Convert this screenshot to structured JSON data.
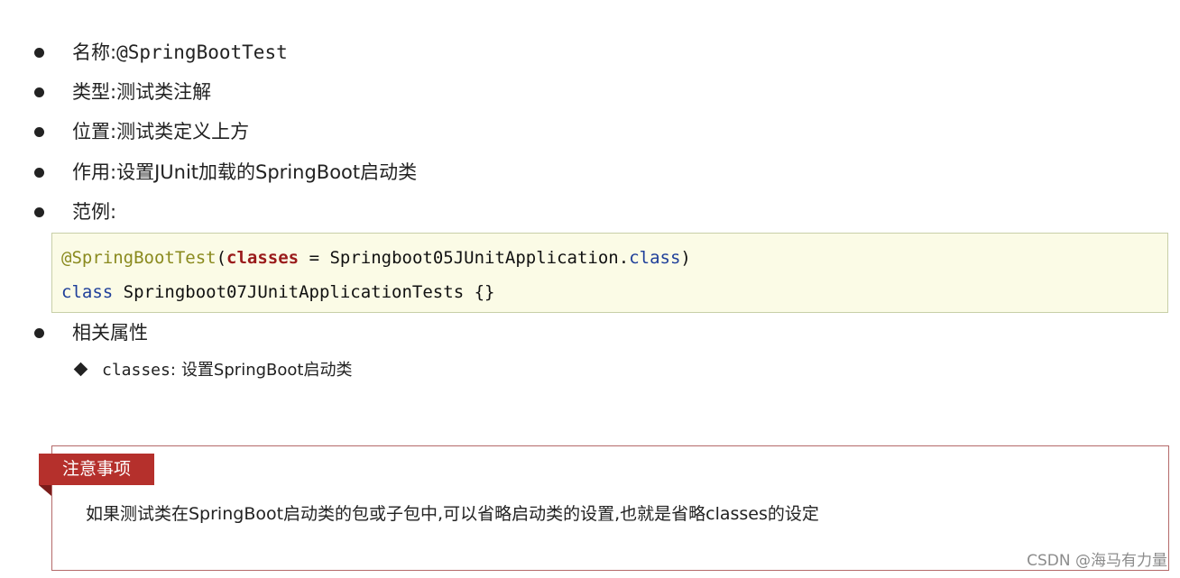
{
  "bullets": [
    {
      "label": "名称:",
      "value": "@SpringBootTest"
    },
    {
      "label": "类型:",
      "value": "测试类注解"
    },
    {
      "label": "位置:",
      "value": "测试类定义上方"
    },
    {
      "label": "作用:",
      "value": "设置JUnit加载的SpringBoot启动类"
    },
    {
      "label": "范例:",
      "value": ""
    }
  ],
  "code": {
    "line1": {
      "annotation": "@SpringBootTest",
      "paren_open": "(",
      "attr": "classes",
      "equals": " = ",
      "class_ref": "Springboot05JUnitApplication.",
      "class_kw": "class",
      "paren_close": ")"
    },
    "line2": {
      "keyword": "class",
      "rest": " Springboot07JUnitApplicationTests {}"
    }
  },
  "related": {
    "label": "相关属性",
    "items": [
      {
        "name": "classes",
        "sep": ":",
        "desc": "设置SpringBoot启动类"
      }
    ]
  },
  "note": {
    "tag": "注意事项",
    "text": "如果测试类在SpringBoot启动类的包或子包中,可以省略启动类的设置,也就是省略classes的设定"
  },
  "watermark": "CSDN @海马有力量",
  "colors": {
    "annotation": "#8a8a1e",
    "attribute": "#9a1b1b",
    "keyword": "#1f3f9a",
    "code_bg": "#fbfbe6",
    "note_tag_bg": "#b5302c",
    "note_border": "#b46a6a"
  }
}
